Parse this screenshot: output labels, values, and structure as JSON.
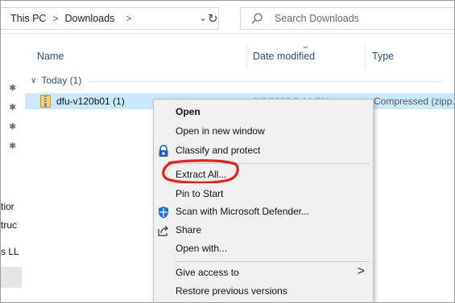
{
  "address": {
    "crumbs": [
      "This PC",
      "Downloads"
    ],
    "separator": ">",
    "dropdown_glyph": "⌄",
    "refresh_glyph": "↻"
  },
  "search": {
    "placeholder": "Search Downloads"
  },
  "columns": {
    "name": "Name",
    "date": "Date modified",
    "type": "Type"
  },
  "nav": {
    "fragments": [
      "tior",
      "truc",
      "s LL"
    ]
  },
  "group": {
    "label": "Today (1)"
  },
  "file": {
    "name": "dfu-v120b01 (1)",
    "date": "8/6/2023 3:44 PM",
    "type": "Compressed (zipp..."
  },
  "menu": {
    "items": [
      {
        "label": "Open",
        "bold": true,
        "icon": ""
      },
      {
        "label": "Open in new window",
        "bold": false,
        "icon": ""
      },
      {
        "label": "Classify and protect",
        "bold": false,
        "icon": "lock-shield-icon"
      },
      {
        "label": "Extract All...",
        "bold": false,
        "icon": ""
      },
      {
        "label": "Pin to Start",
        "bold": false,
        "icon": ""
      },
      {
        "label": "Scan with Microsoft Defender...",
        "bold": false,
        "icon": "defender-icon"
      },
      {
        "label": "Share",
        "bold": false,
        "icon": "share-icon"
      },
      {
        "label": "Open with...",
        "bold": false,
        "icon": ""
      },
      {
        "label": "Give access to",
        "bold": false,
        "icon": "",
        "submenu": true
      },
      {
        "label": "Restore previous versions",
        "bold": false,
        "icon": ""
      }
    ],
    "submenu_glyph": ">"
  },
  "annotation": {
    "color": "#e0231e",
    "target": "Extract All..."
  },
  "colors": {
    "selection": "#cce8ff",
    "menu_bg": "#f0f0f0",
    "header_text": "#2d4d7a"
  }
}
